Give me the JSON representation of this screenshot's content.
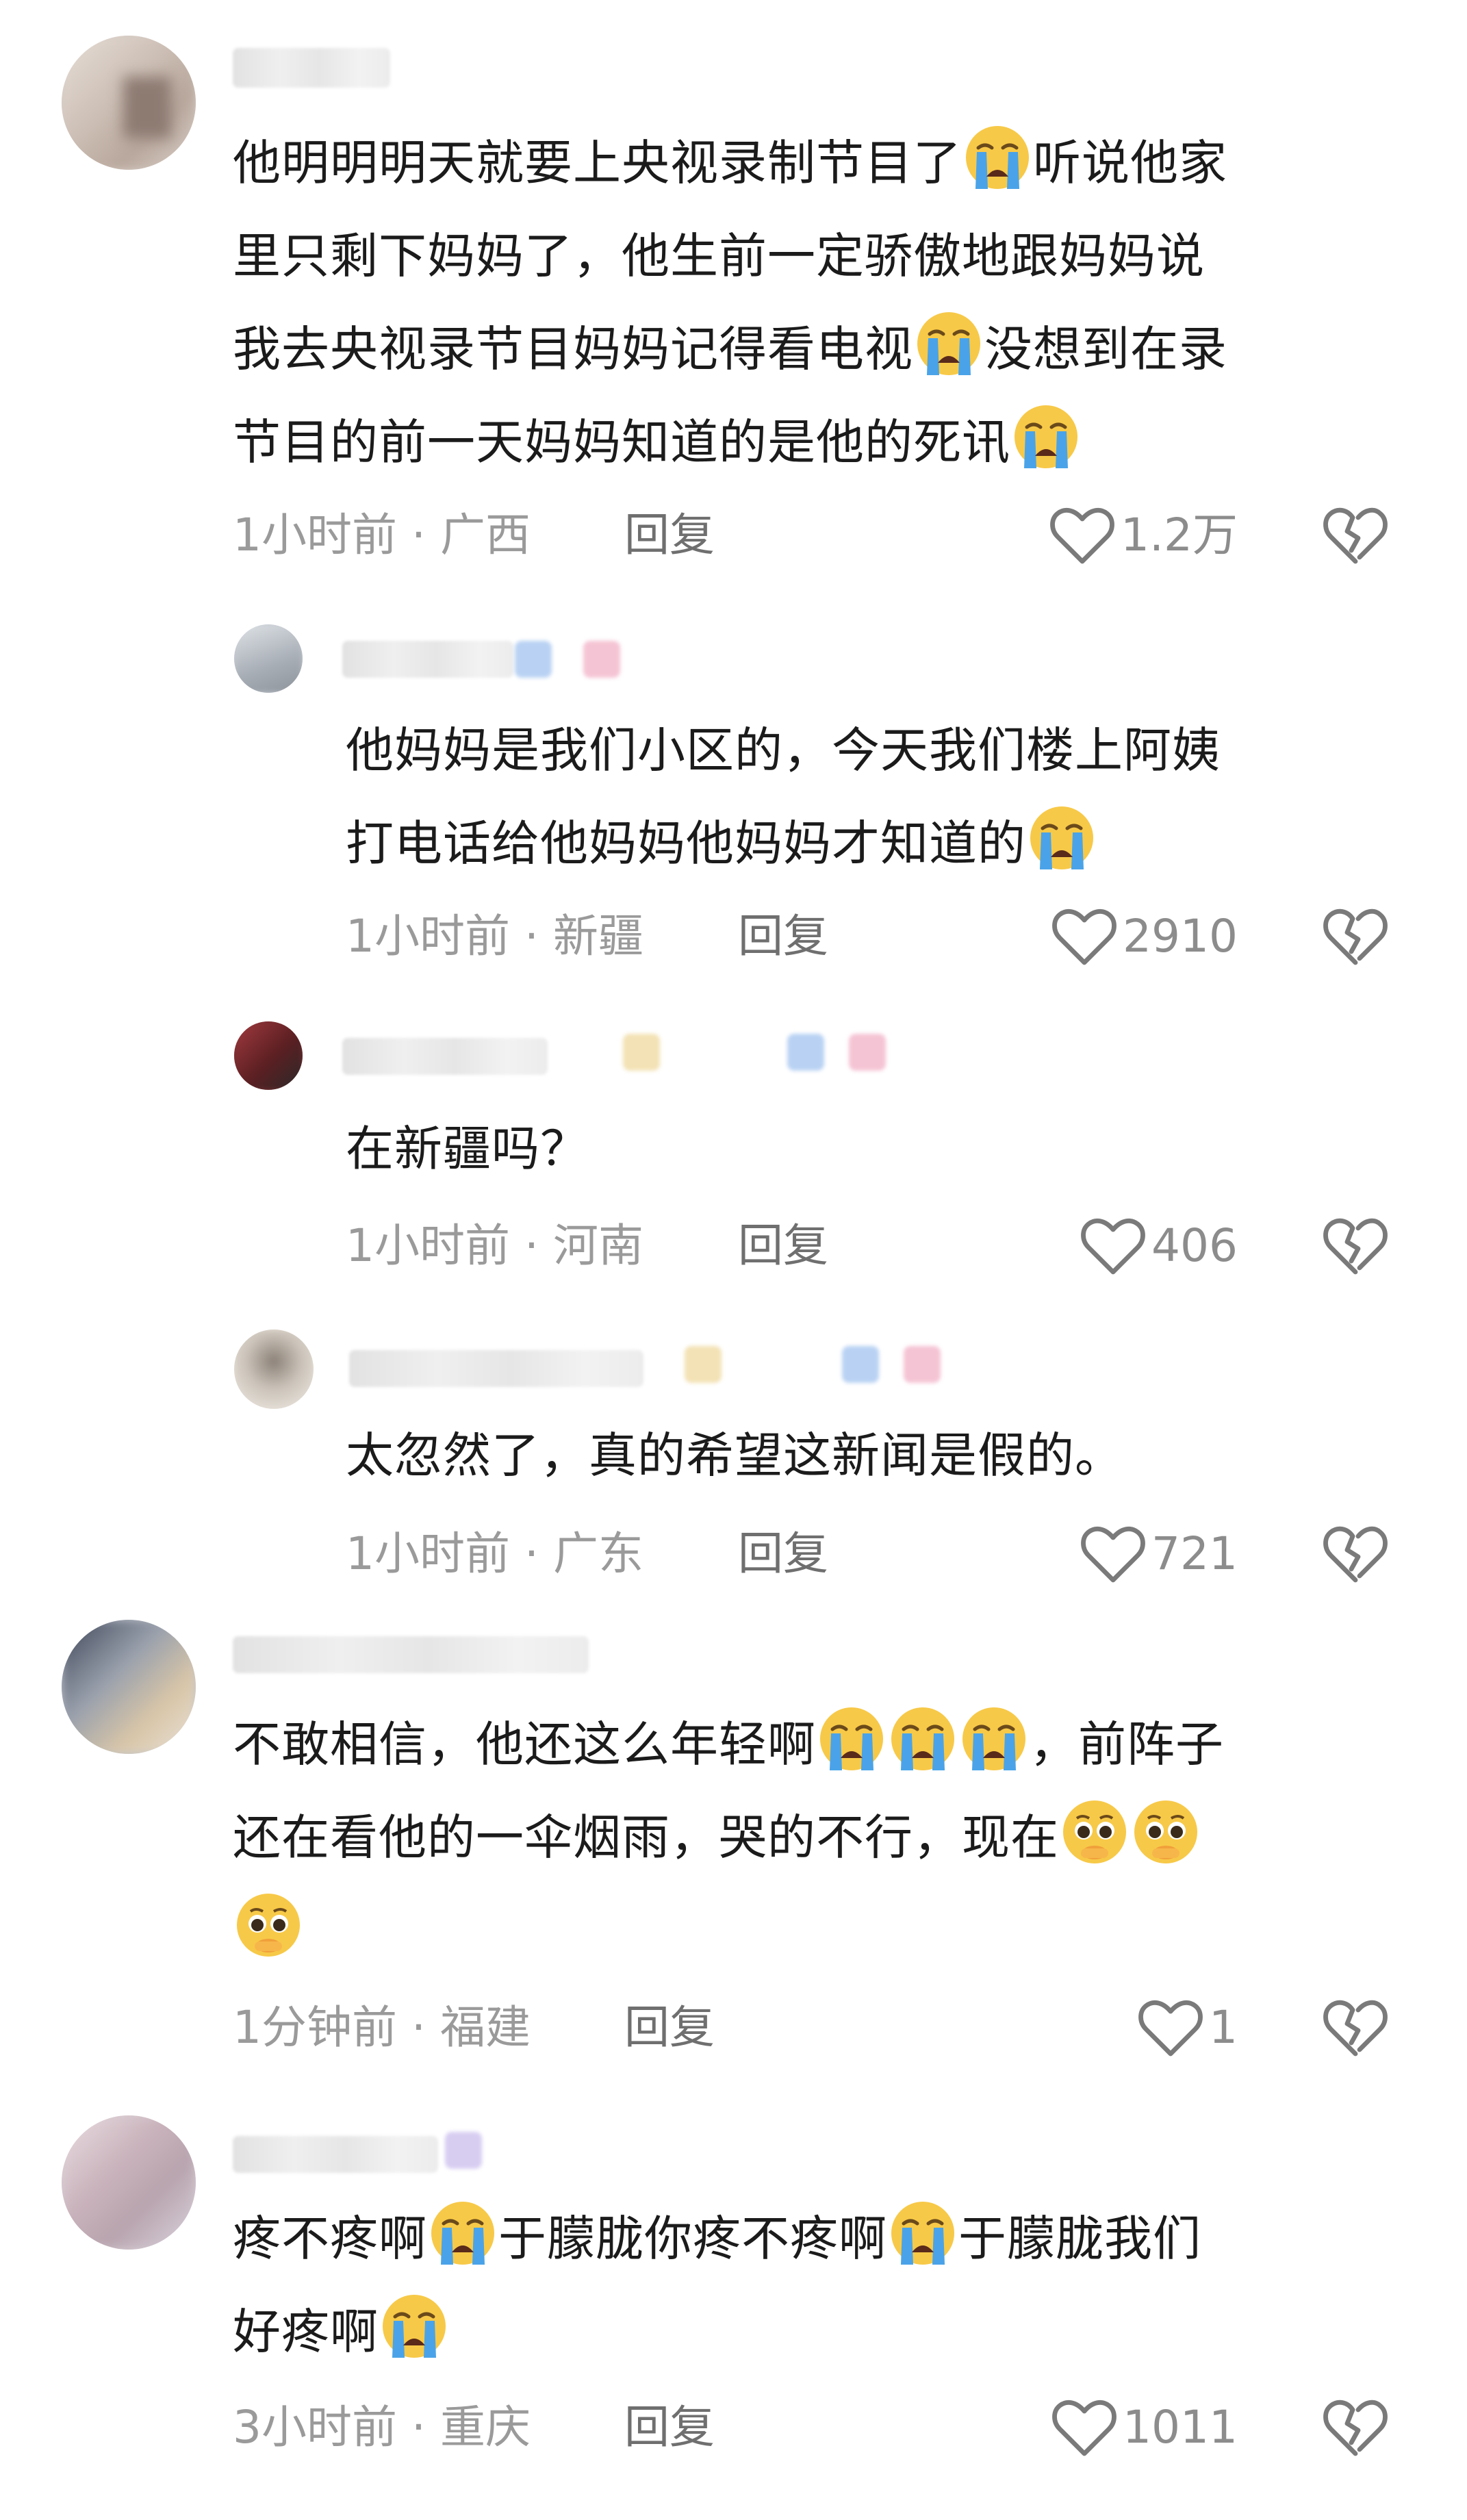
{
  "comments": [
    {
      "lines": [
        [
          {
            "t": "他明明明天就要上央视录制节目了"
          },
          {
            "e": "crying"
          },
          {
            "t": "听说他家"
          }
        ],
        [
          {
            "t": "里只剩下妈妈了，他生前一定骄傲地跟妈妈说"
          }
        ],
        [
          {
            "t": "我去央视录节目妈妈记得看电视"
          },
          {
            "e": "crying"
          },
          {
            "t": "没想到在录"
          }
        ],
        [
          {
            "t": "节目的前一天妈妈知道的是他的死讯"
          },
          {
            "e": "crying"
          }
        ]
      ],
      "time": "1小时前",
      "location": "广西",
      "reply_label": "回复",
      "likes": "1.2万"
    },
    {
      "lines": [
        [
          {
            "t": "他妈妈是我们小区的，今天我们楼上阿姨"
          }
        ],
        [
          {
            "t": "打电话给他妈妈他妈妈才知道的"
          },
          {
            "e": "crying"
          }
        ]
      ],
      "time": "1小时前",
      "location": "新疆",
      "reply_label": "回复",
      "likes": "2910"
    },
    {
      "lines": [
        [
          {
            "t": "在新疆吗？"
          }
        ]
      ],
      "time": "1小时前",
      "location": "河南",
      "reply_label": "回复",
      "likes": "406"
    },
    {
      "lines": [
        [
          {
            "t": "太忽然了，真的希望这新闻是假的。"
          }
        ]
      ],
      "time": "1小时前",
      "location": "广东",
      "reply_label": "回复",
      "likes": "721"
    },
    {
      "lines": [
        [
          {
            "t": "不敢相信，他还这么年轻啊"
          },
          {
            "e": "crying"
          },
          {
            "e": "crying"
          },
          {
            "e": "crying"
          },
          {
            "t": "，前阵子"
          }
        ],
        [
          {
            "t": "还在看他的一伞烟雨，哭的不行，现在"
          },
          {
            "e": "pleading"
          },
          {
            "e": "pleading"
          }
        ],
        [
          {
            "e": "pleading"
          }
        ]
      ],
      "time": "1分钟前",
      "location": "福建",
      "reply_label": "回复",
      "likes": "1"
    },
    {
      "lines": [
        [
          {
            "t": "疼不疼啊"
          },
          {
            "e": "crying"
          },
          {
            "t": "于朦胧你疼不疼啊"
          },
          {
            "e": "crying"
          },
          {
            "t": "于朦胧我们"
          }
        ],
        [
          {
            "t": "好疼啊"
          },
          {
            "e": "crying"
          }
        ]
      ],
      "time": "3小时前",
      "location": "重庆",
      "reply_label": "回复",
      "likes": "1011"
    }
  ],
  "meta_separator": " · ",
  "icons": {
    "like": "heart-outline-icon",
    "dislike": "broken-heart-icon",
    "emoji_crying": "loudly-crying-face-emoji",
    "emoji_pleading": "pleading-face-emoji"
  },
  "colors": {
    "text": "#1b1b1b",
    "meta": "#9a9a9a",
    "reply": "#6f6f6f",
    "icon": "#7a7a7a",
    "emoji_face": "#f7c948",
    "emoji_tear": "#4aa3e8"
  }
}
